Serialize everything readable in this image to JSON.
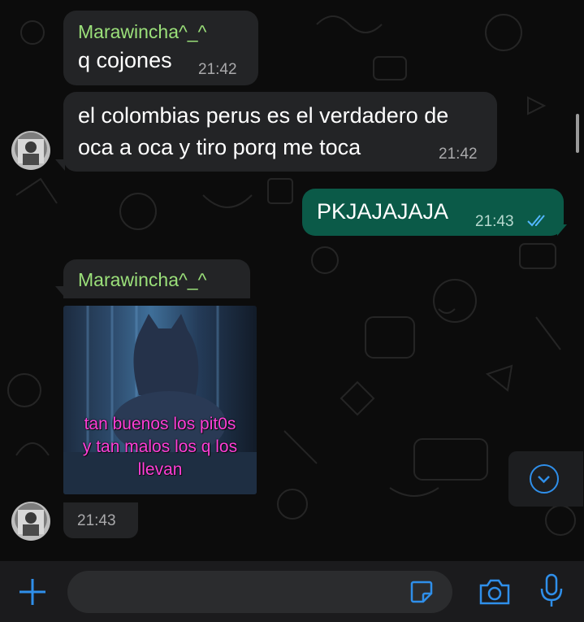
{
  "messages": [
    {
      "sender": "Marawincha^_^",
      "text": "q cojones",
      "time": "21:42"
    },
    {
      "text_line1": "el colombias perus es el verdadero de",
      "text_line2": "oca a oca y tiro porq me toca",
      "time": "21:42"
    },
    {
      "text": "PKJAJAJAJA",
      "time": "21:43",
      "status": "read"
    },
    {
      "sender": "Marawincha^_^",
      "image_caption_lines": [
        "tan buenos los pit0s",
        "y tan malos los q los",
        "llevan"
      ],
      "time": "21:43"
    }
  ],
  "icons": {
    "add": "plus-icon",
    "sticker": "sticker-icon",
    "camera": "camera-icon",
    "mic": "microphone-icon",
    "scroll": "chevron-down-icon",
    "read_receipt": "double-check-icon"
  },
  "colors": {
    "incoming_bubble": "#232426",
    "outgoing_bubble": "#0b5a48",
    "sender_name": "#9be07a",
    "accent": "#2f8fea"
  },
  "composer": {
    "placeholder": ""
  }
}
